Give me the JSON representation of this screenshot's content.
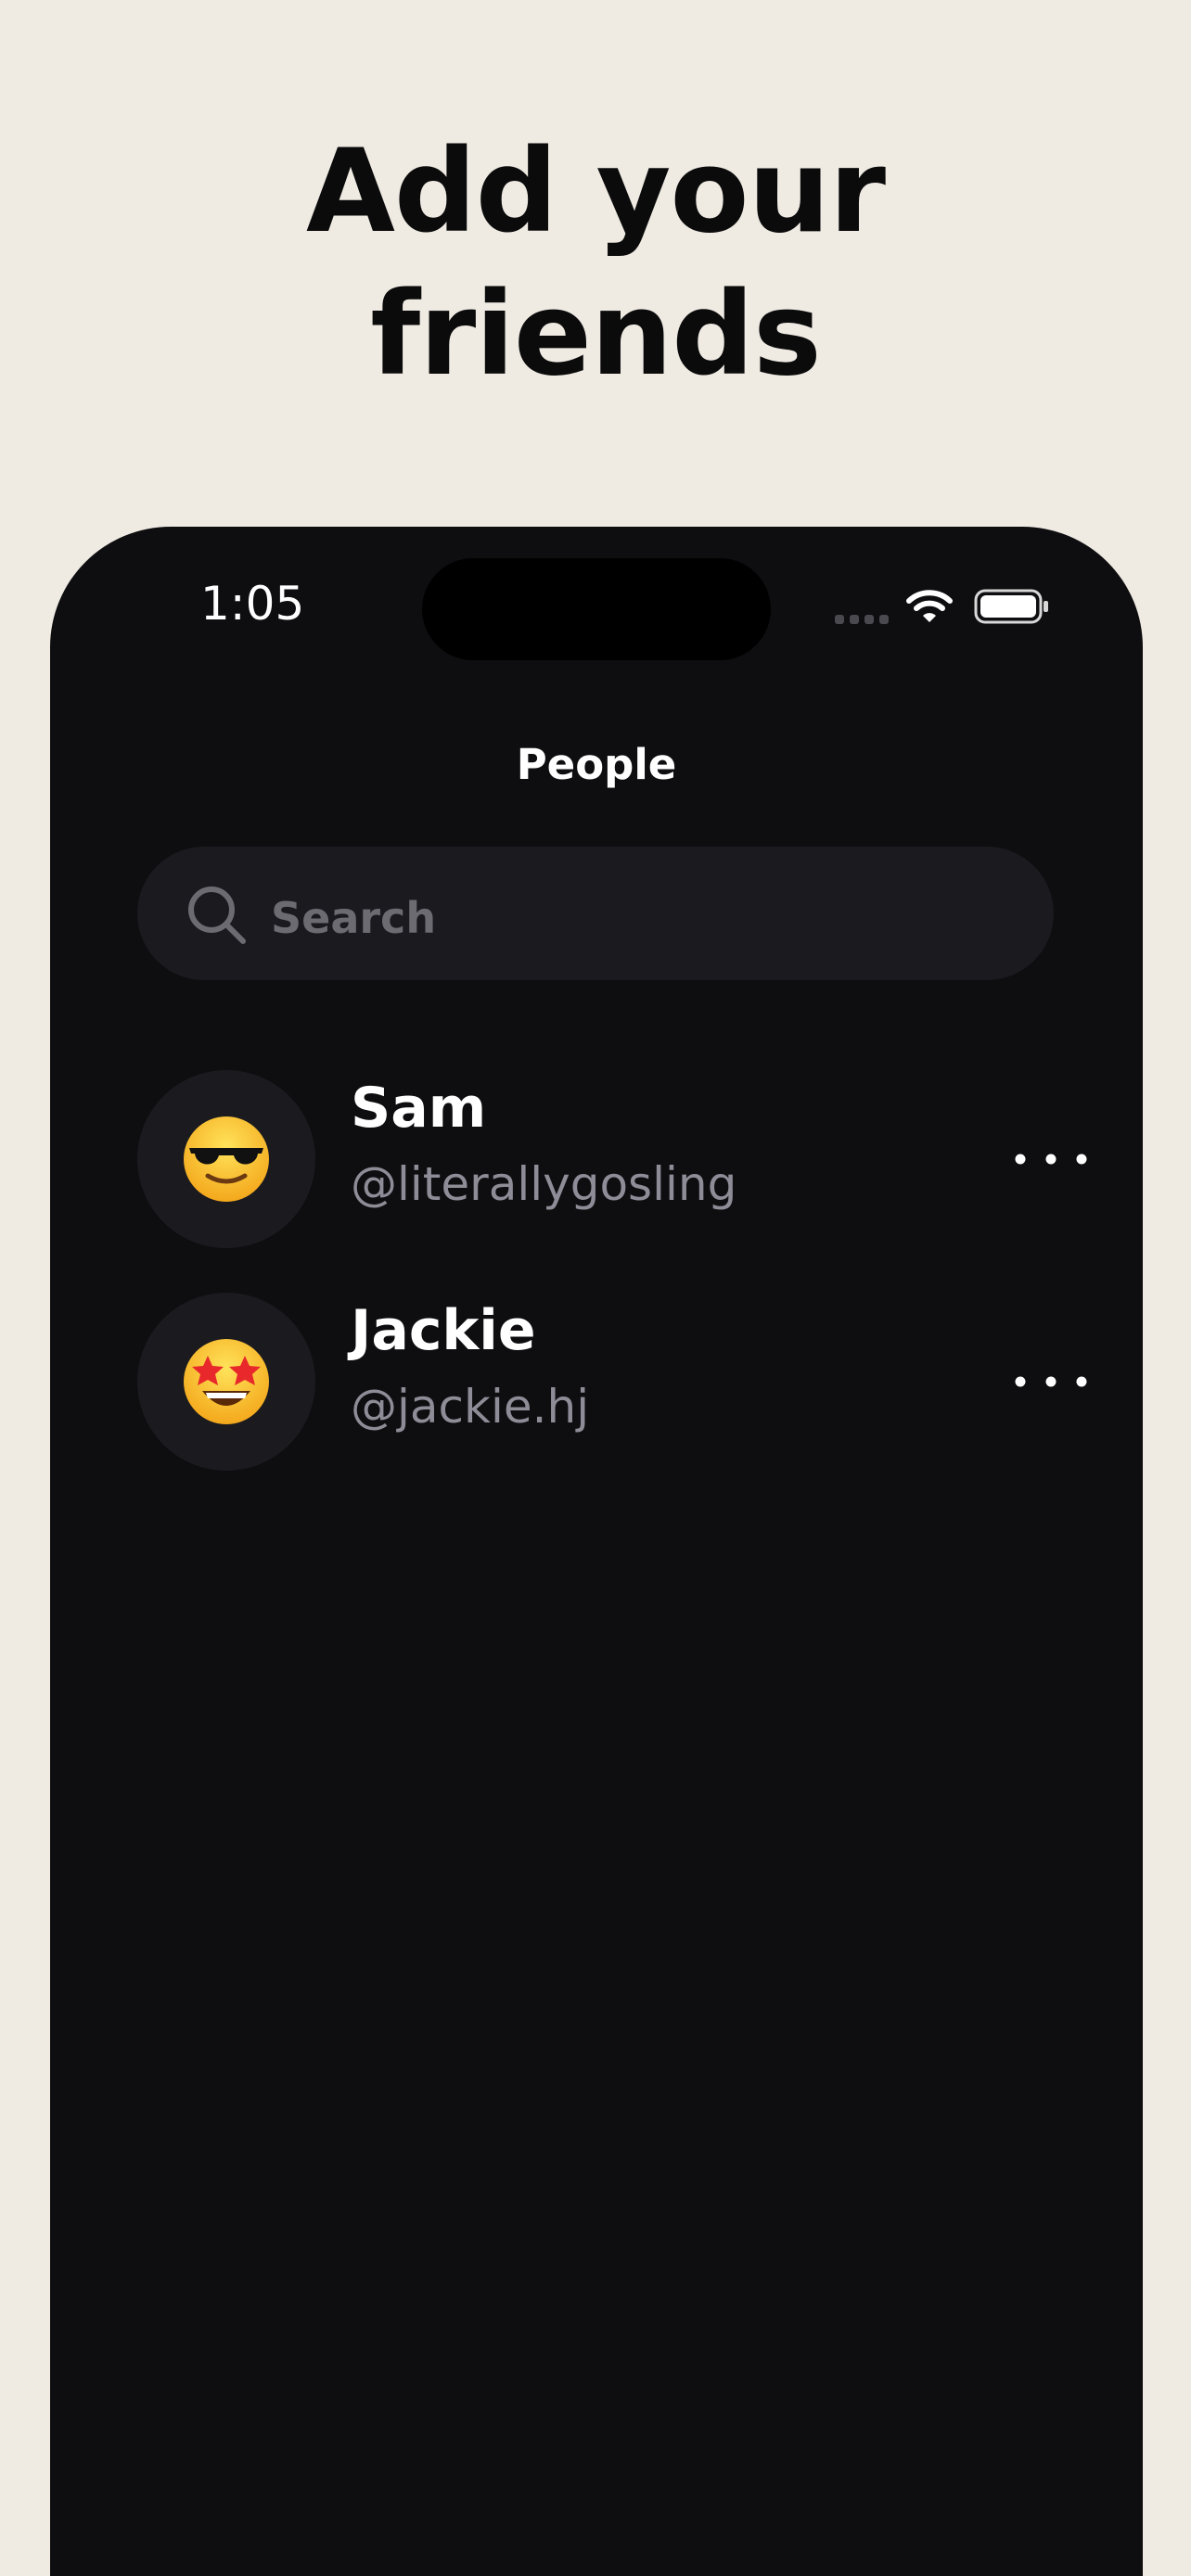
{
  "headline": {
    "line1": "Add your",
    "line2": "friends"
  },
  "status_bar": {
    "time": "1:05",
    "icons": [
      "cellular-signal-icon",
      "wifi-icon",
      "battery-icon"
    ]
  },
  "screen": {
    "title": "People",
    "search": {
      "placeholder": "Search",
      "icon": "search-icon"
    },
    "people": [
      {
        "name": "Sam",
        "handle": "@literallygosling",
        "avatar": "sunglasses-face-emoji",
        "menu_icon": "more-horizontal-icon"
      },
      {
        "name": "Jackie",
        "handle": "@jackie.hj",
        "avatar": "star-struck-face-emoji",
        "menu_icon": "more-horizontal-icon"
      }
    ]
  },
  "colors": {
    "background": "#EFEBE3",
    "phone": "#0E0D10",
    "surface": "#1B1A1F",
    "text_primary": "#FFFFFF",
    "text_secondary": "#8E8C96",
    "headline": "#0B0B0C"
  }
}
